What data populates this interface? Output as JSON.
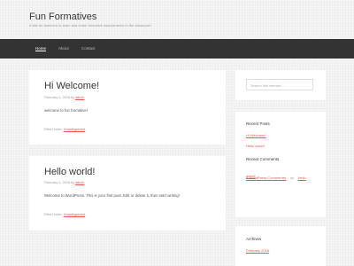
{
  "site": {
    "title": "Fun Formatives",
    "description": "A site for teachers to learn and share formative assessments in the classroom"
  },
  "nav": {
    "items": [
      {
        "label": "Home",
        "active": true
      },
      {
        "label": "About",
        "active": false
      },
      {
        "label": "Contact",
        "active": false
      }
    ]
  },
  "posts": [
    {
      "title": "Hi Welcome!",
      "date": "February 2, 2018",
      "by": "by",
      "author": "admin",
      "content": "welcome to fun formative!",
      "filed_label": "Filed Under:",
      "category": "Uncategorized"
    },
    {
      "title": "Hello world!",
      "date": "February 2, 2018",
      "by": "by",
      "author": "admin",
      "content": "Welcome to WordPress. This is your first post. Edit or delete it, then start writing!",
      "filed_label": "Filed Under:",
      "category": "Uncategorized"
    }
  ],
  "sidebar": {
    "search_placeholder": "Search this website …",
    "recent_posts": {
      "title": "Recent Posts",
      "items": [
        "Hi Welcome!",
        "Hello world!"
      ]
    },
    "recent_comments": {
      "title": "Recent Comments",
      "author": "A WordPress Commenter",
      "on": "on",
      "post_part1": "Hello",
      "post_part2": "world!"
    },
    "archives": {
      "title": "Archives",
      "items": [
        "February 2018"
      ]
    }
  },
  "colors": {
    "accent": "#e5554e",
    "nav_bg": "#333333"
  }
}
